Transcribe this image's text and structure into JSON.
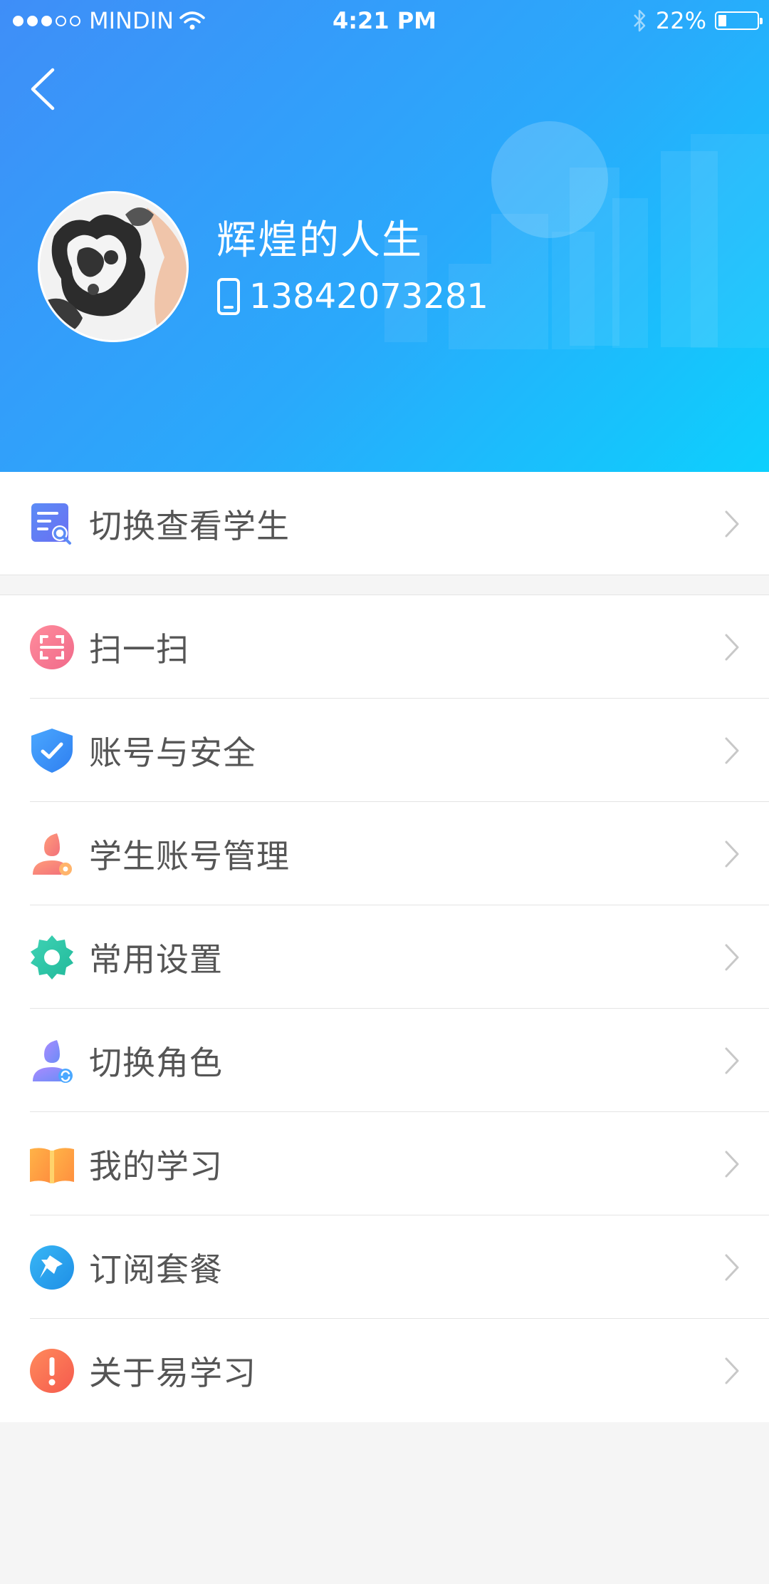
{
  "status_bar": {
    "carrier": "MINDIN",
    "time": "4:21 PM",
    "battery": "22%",
    "signal_dots_filled": 3,
    "signal_dots_total": 5
  },
  "profile": {
    "name": "辉煌的人生",
    "phone": "13842073281"
  },
  "colors": {
    "header_start": "#3f8ef8",
    "header_end": "#0dd0fd",
    "background": "#f5f5f5"
  },
  "menu_top": [
    {
      "label": "切换查看学生",
      "icon": "student-search-icon"
    }
  ],
  "menu_main": [
    {
      "label": "扫一扫",
      "icon": "scan-icon"
    },
    {
      "label": "账号与安全",
      "icon": "shield-icon"
    },
    {
      "label": "学生账号管理",
      "icon": "user-settings-icon"
    },
    {
      "label": "常用设置",
      "icon": "gear-icon"
    },
    {
      "label": "切换角色",
      "icon": "switch-role-icon"
    },
    {
      "label": "我的学习",
      "icon": "book-icon"
    },
    {
      "label": "订阅套餐",
      "icon": "pin-icon"
    },
    {
      "label": "关于易学习",
      "icon": "info-icon"
    }
  ]
}
